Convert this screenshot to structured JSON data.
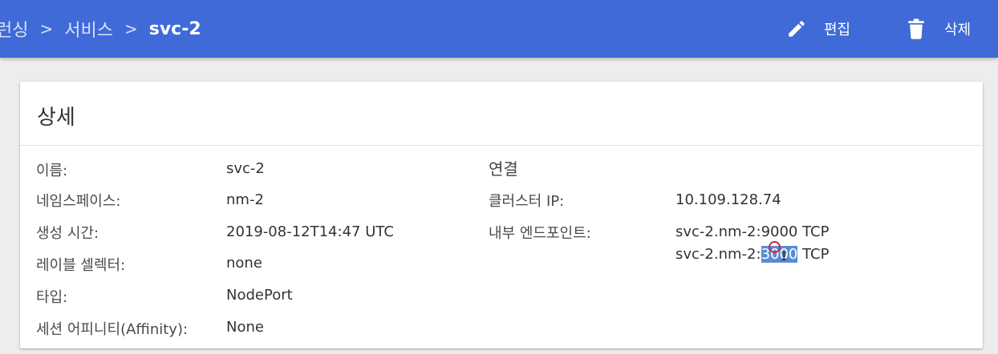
{
  "breadcrumb": {
    "items": [
      "런싱",
      "서비스"
    ],
    "separator": ">",
    "current": "svc-2"
  },
  "actions": {
    "edit_label": "편집",
    "edit_icon": "pencil-icon",
    "delete_label": "삭제",
    "delete_icon": "trash-icon"
  },
  "details": {
    "title": "상세",
    "fields": [
      {
        "label": "이름:",
        "value": "svc-2"
      },
      {
        "label": "네임스페이스:",
        "value": "nm-2"
      },
      {
        "label": "생성 시간:",
        "value": "2019-08-12T14:47 UTC"
      },
      {
        "label": "레이블 셀렉터:",
        "value": "none"
      },
      {
        "label": "타입:",
        "value": "NodePort"
      },
      {
        "label": "세션 어피니티(Affinity):",
        "value": "None"
      }
    ]
  },
  "connection": {
    "title": "연결",
    "cluster_ip_label": "클러스터 IP:",
    "cluster_ip": "10.109.128.74",
    "endpoints_label": "내부 엔드포인트:",
    "endpoints": [
      {
        "host": "svc-2.nm-2:",
        "port": "9000",
        "protocol": "TCP"
      },
      {
        "host": "svc-2.nm-2:",
        "port": "3000",
        "protocol": "TCP"
      }
    ],
    "selected_text": "3000"
  },
  "colors": {
    "topbar": "#3f6ad8",
    "selection": "#5b8bd6",
    "cursor": "#d2263a"
  }
}
